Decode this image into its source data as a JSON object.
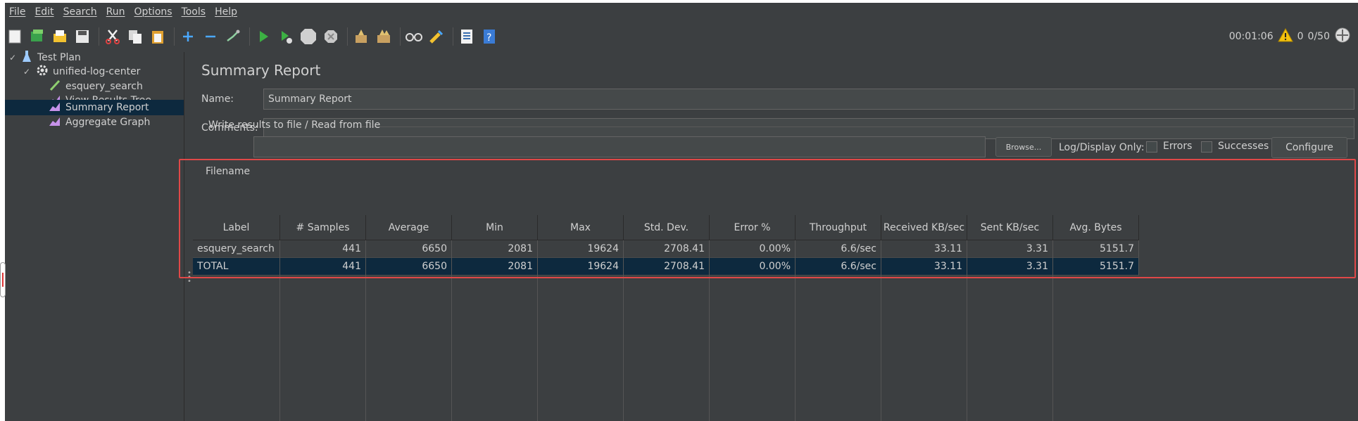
{
  "menu": [
    "File",
    "Edit",
    "Search",
    "Run",
    "Options",
    "Tools",
    "Help"
  ],
  "toolbar": {
    "icons": [
      "new-icon",
      "templates-icon",
      "open-icon",
      "save-icon",
      "cut-icon",
      "copy-icon",
      "paste-icon",
      "expand-icon",
      "collapse-icon",
      "toggle-icon",
      "start-icon",
      "start-no-pauses-icon",
      "stop-icon",
      "shutdown-icon",
      "clear-icon",
      "clear-all-icon",
      "search-icon",
      "reset-search-icon",
      "function-helper-icon",
      "help-icon"
    ],
    "timer": "00:01:06",
    "warnings": "0",
    "threads": "0/50"
  },
  "tree": {
    "items": [
      {
        "label": "Test Plan",
        "icon": "test-plan-icon",
        "depth": 0,
        "expanded": true
      },
      {
        "label": "unified-log-center",
        "icon": "thread-group-gear-icon",
        "depth": 1,
        "expanded": true
      },
      {
        "label": "esquery_search",
        "icon": "sampler-pen-icon",
        "depth": 2
      },
      {
        "label": "View Results Tree",
        "icon": "listener-graph-icon",
        "depth": 2
      },
      {
        "label": "Summary Report",
        "icon": "listener-graph-icon",
        "depth": 2,
        "selected": true
      },
      {
        "label": "Aggregate Graph",
        "icon": "listener-graph-icon",
        "depth": 2
      }
    ]
  },
  "panel": {
    "title": "Summary Report",
    "name_label": "Name:",
    "name_value": "Summary Report",
    "comments_label": "Comments:",
    "comments_value": "",
    "group_title": "Write results to file / Read from file",
    "filename_label": "Filename",
    "filename_value": "",
    "browse_label": "Browse...",
    "log_display_label": "Log/Display Only:",
    "errors_label": "Errors",
    "successes_label": "Successes",
    "configure_label": "Configure"
  },
  "table": {
    "columns": [
      "Label",
      "# Samples",
      "Average",
      "Min",
      "Max",
      "Std. Dev.",
      "Error %",
      "Throughput",
      "Received KB/sec",
      "Sent KB/sec",
      "Avg. Bytes"
    ],
    "rows": [
      [
        "esquery_search",
        "441",
        "6650",
        "2081",
        "19624",
        "2708.41",
        "0.00%",
        "6.6/sec",
        "33.11",
        "3.31",
        "5151.7"
      ],
      [
        "TOTAL",
        "441",
        "6650",
        "2081",
        "19624",
        "2708.41",
        "0.00%",
        "6.6/sec",
        "33.11",
        "3.31",
        "5151.7"
      ]
    ],
    "selected_row": 1
  },
  "colors": {
    "background": "#3c3f41",
    "selection": "#0d293e",
    "highlight": "#e04848",
    "text": "#d0d0d0"
  }
}
